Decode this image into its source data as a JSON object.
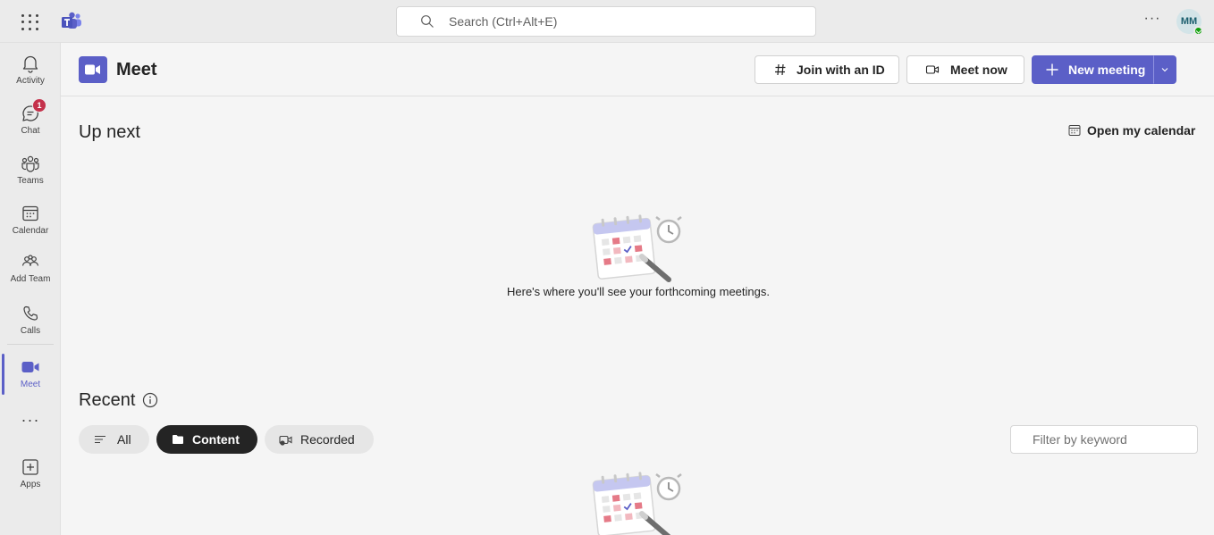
{
  "topbar": {
    "search_placeholder": "Search (Ctrl+Alt+E)",
    "more_label": "···",
    "avatar_initials": "MM"
  },
  "rail": {
    "items": [
      {
        "label": "Activity",
        "icon": "bell-icon"
      },
      {
        "label": "Chat",
        "icon": "chat-icon",
        "badge": "1"
      },
      {
        "label": "Teams",
        "icon": "teams-icon"
      },
      {
        "label": "Calendar",
        "icon": "calendar-icon"
      },
      {
        "label": "Add Team",
        "icon": "people-add-icon"
      },
      {
        "label": "Calls",
        "icon": "phone-icon"
      },
      {
        "label": "Meet",
        "icon": "video-icon",
        "active": true
      },
      {
        "label": "Apps",
        "icon": "apps-add-icon"
      }
    ],
    "more_label": "···"
  },
  "header": {
    "title": "Meet",
    "join_label": "Join with an ID",
    "meet_now_label": "Meet now",
    "new_meeting_label": "New meeting"
  },
  "upnext": {
    "title": "Up next",
    "open_calendar_label": "Open my calendar",
    "empty_message": "Here's where you'll see your forthcoming meetings."
  },
  "recent": {
    "title": "Recent",
    "filters": [
      "All",
      "Content",
      "Recorded"
    ],
    "active_filter": "Content",
    "filter_placeholder": "Filter by keyword"
  },
  "colors": {
    "accent": "#5b5fc7",
    "badge": "#c4314b",
    "presence": "#13a10e"
  }
}
